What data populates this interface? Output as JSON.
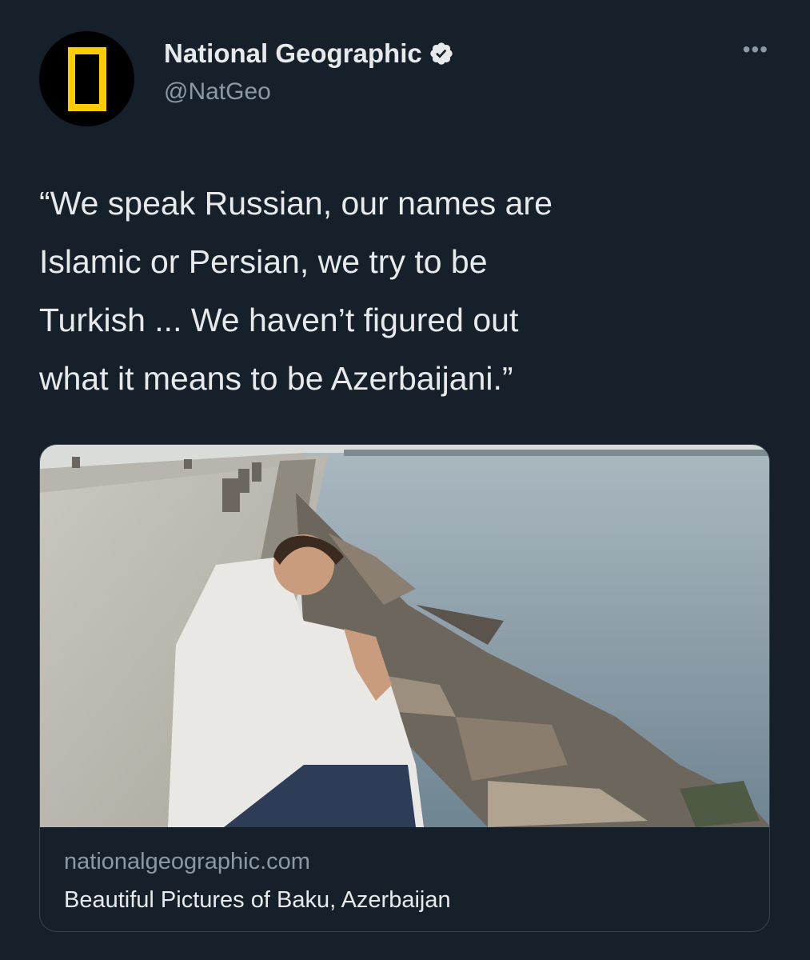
{
  "author": {
    "name": "National Geographic",
    "handle": "@NatGeo",
    "verified_icon": "verified-badge-icon",
    "avatar_icon": "natgeo-yellow-frame-logo"
  },
  "tweet": {
    "text": "“We speak Russian, our names are\nIslamic or Persian, we try to be\nTurkish ... We haven’t figured out\nwhat it means to be Azerbaijani.”"
  },
  "more_icon": "more-options-icon",
  "card": {
    "domain": "nationalgeographic.com",
    "title": "Beautiful Pictures of Baku, Azerbaijan",
    "image_icon": "photo-man-sitting-on-seawall"
  },
  "colors": {
    "background": "#15202b",
    "brand_yellow": "#ffcc00",
    "secondary_text": "#8b98a5",
    "primary_text": "#e7e9ea",
    "border": "#38444d"
  }
}
